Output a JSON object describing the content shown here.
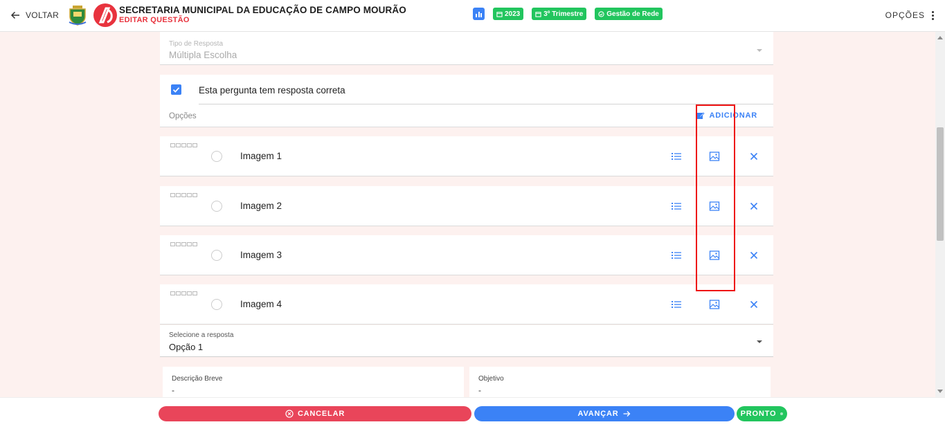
{
  "header": {
    "back_label": "VOLTAR",
    "org_title": "SECRETARIA MUNICIPAL DA EDUCAÇÃO DE CAMPO MOURÃO",
    "page_subtitle": "EDITAR QUESTÃO",
    "badges": {
      "year": "2023",
      "period": "3º Trimestre",
      "network": "Gestão de Rede"
    },
    "options_label": "OPÇÕES"
  },
  "form": {
    "response_type": {
      "label": "Tipo de Resposta",
      "value": "Múltipla Escolha"
    },
    "has_correct_answer": {
      "label": "Esta pergunta tem resposta correta",
      "checked": true
    },
    "options_section": {
      "label": "Opções",
      "add_label": "ADICIONAR"
    },
    "options": [
      {
        "label": "Imagem 1"
      },
      {
        "label": "Imagem 2"
      },
      {
        "label": "Imagem 3"
      },
      {
        "label": "Imagem 4"
      }
    ],
    "select_answer": {
      "label": "Selecione a resposta",
      "value": "Opção 1"
    },
    "brief_description": {
      "label": "Descrição Breve",
      "value": "-"
    },
    "objective": {
      "label": "Objetivo",
      "value": "-"
    }
  },
  "footer": {
    "cancel_label": "CANCELAR",
    "next_label": "AVANÇAR",
    "done_label": "PRONTO"
  },
  "colors": {
    "primary": "#3b82f6",
    "danger": "#e9455a",
    "success": "#22c55e",
    "brand_red": "#e8333e",
    "background": "#fdf1ef"
  }
}
